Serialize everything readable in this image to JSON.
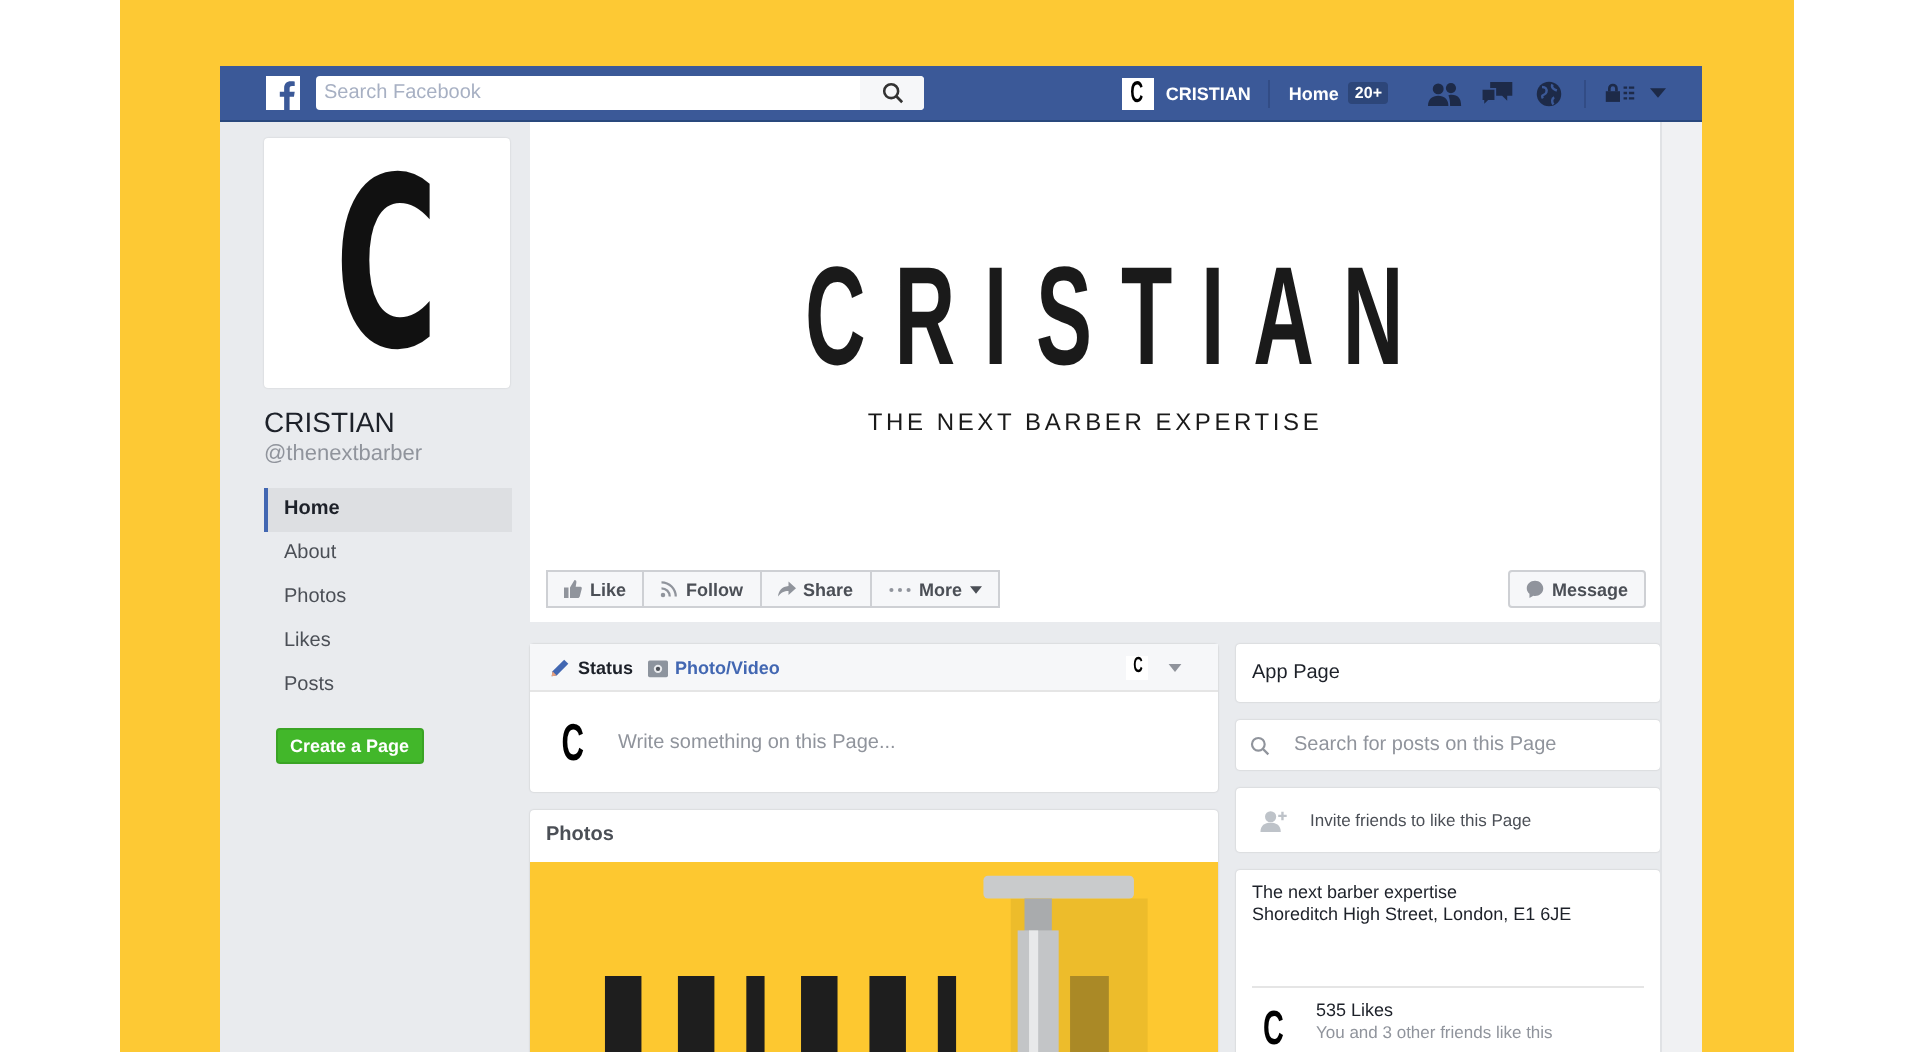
{
  "topbar": {
    "search_placeholder": "Search Facebook",
    "avatar_letter": "C",
    "profile_name": "CRISTIAN",
    "home_label": "Home",
    "notification_badge": "20+"
  },
  "sidebar": {
    "logo_letter": "C",
    "page_name": "CRISTIAN",
    "handle": "@thenextbarber",
    "nav": [
      {
        "label": "Home",
        "selected": true
      },
      {
        "label": "About",
        "selected": false
      },
      {
        "label": "Photos",
        "selected": false
      },
      {
        "label": "Likes",
        "selected": false
      },
      {
        "label": "Posts",
        "selected": false
      }
    ],
    "create_button": "Create a Page"
  },
  "cover": {
    "title": "CRISTIAN",
    "subtitle": "THE NEXT BARBER EXPERTISE",
    "actions": [
      {
        "label": "Like",
        "kind": "like"
      },
      {
        "label": "Follow",
        "kind": "follow"
      },
      {
        "label": "Share",
        "kind": "share"
      },
      {
        "label": "More",
        "kind": "more"
      }
    ],
    "message_button": "Message"
  },
  "composer": {
    "tabs": [
      {
        "label": "Status",
        "kind": "status",
        "selected": true
      },
      {
        "label": "Photo/Video",
        "selected": false
      }
    ],
    "identity_letter": "C",
    "avatar_letter": "C",
    "placeholder": "Write something on this Page..."
  },
  "photos": {
    "title": "Photos"
  },
  "right": {
    "app_page": "App Page",
    "search_placeholder": "Search for posts on this Page",
    "invite": "Invite friends to like this Page",
    "about": [
      "The next barber expertise",
      "Shoreditch High Street, London, E1 6JE"
    ],
    "likes": {
      "avatar_letter": "C",
      "count": "535 Likes",
      "friends": "You and 3 other friends like this"
    }
  }
}
